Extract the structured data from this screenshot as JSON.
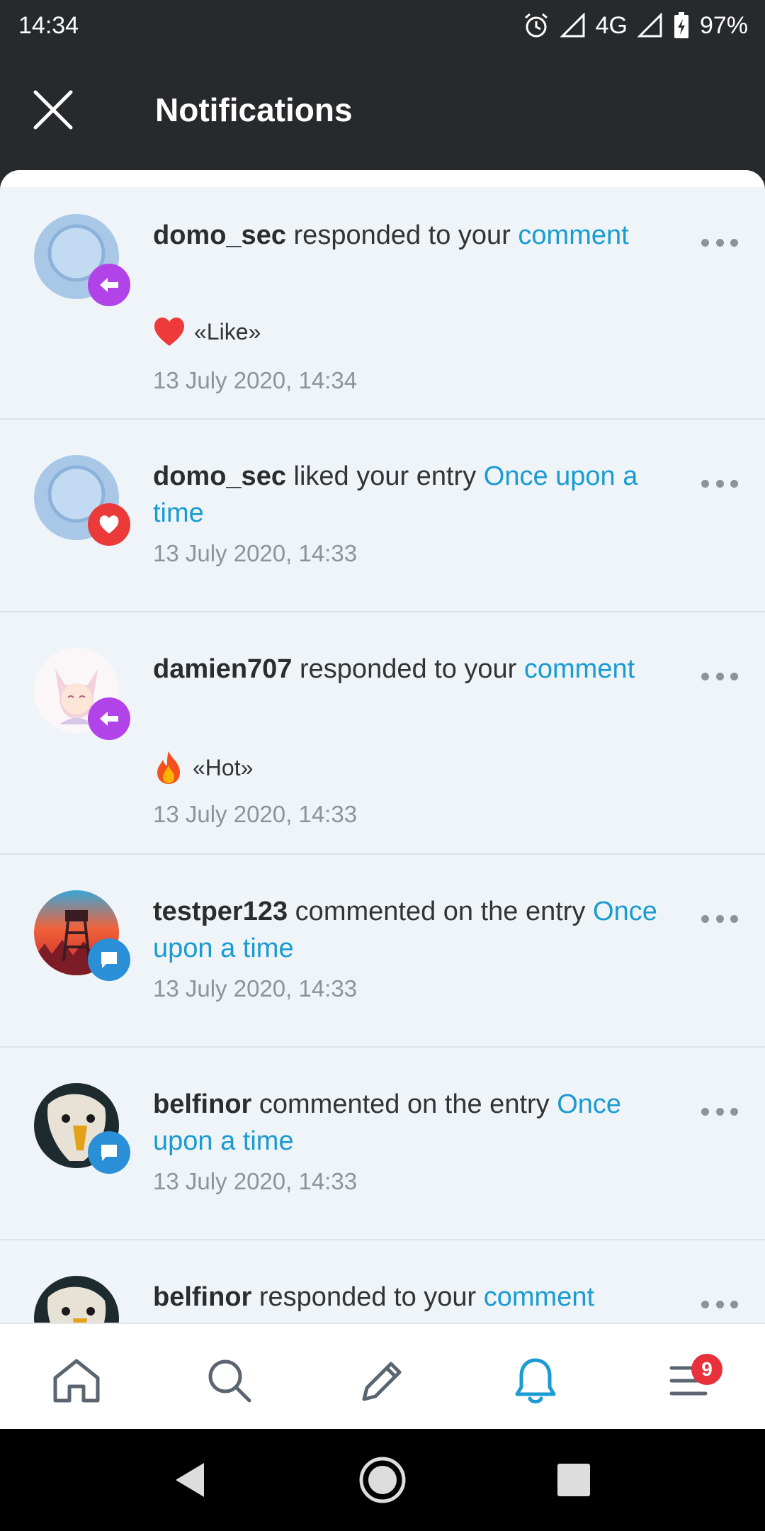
{
  "status_bar": {
    "time": "14:34",
    "network": "4G",
    "battery": "97%"
  },
  "app_bar": {
    "title": "Notifications"
  },
  "notifications": [
    {
      "user": "domo_sec",
      "action": " responded to your ",
      "link": "comment",
      "reaction_text": "«Like»",
      "reaction_icon": "heart-icon",
      "time": "13 July 2020, 14:34",
      "badge_icon": "reply-icon"
    },
    {
      "user": "domo_sec",
      "action": " liked your entry ",
      "link": "Once upon a time",
      "time": "13 July 2020, 14:33",
      "badge_icon": "heart-icon"
    },
    {
      "user": "damien707",
      "action": " responded to your ",
      "link": "comment",
      "reaction_text": "«Hot»",
      "reaction_icon": "fire-icon",
      "time": "13 July 2020, 14:33",
      "badge_icon": "reply-icon"
    },
    {
      "user": "testper123",
      "action": " commented on the entry ",
      "link": "Once upon a time",
      "time": "13 July 2020, 14:33",
      "badge_icon": "comment-icon"
    },
    {
      "user": "belfinor",
      "action": " commented on the entry ",
      "link": "Once upon a time",
      "time": "13 July 2020, 14:33",
      "badge_icon": "comment-icon"
    },
    {
      "user": "belfinor",
      "action": " responded to your ",
      "link": "comment"
    }
  ],
  "bottom_nav": {
    "items": [
      "home-icon",
      "search-icon",
      "pencil-icon",
      "bell-icon",
      "menu-icon"
    ],
    "active": "bell-icon",
    "menu_badge": "9"
  },
  "colors": {
    "link": "#1a9bd1",
    "active_nav": "#1a9bd1",
    "badge": "#e8313a"
  }
}
